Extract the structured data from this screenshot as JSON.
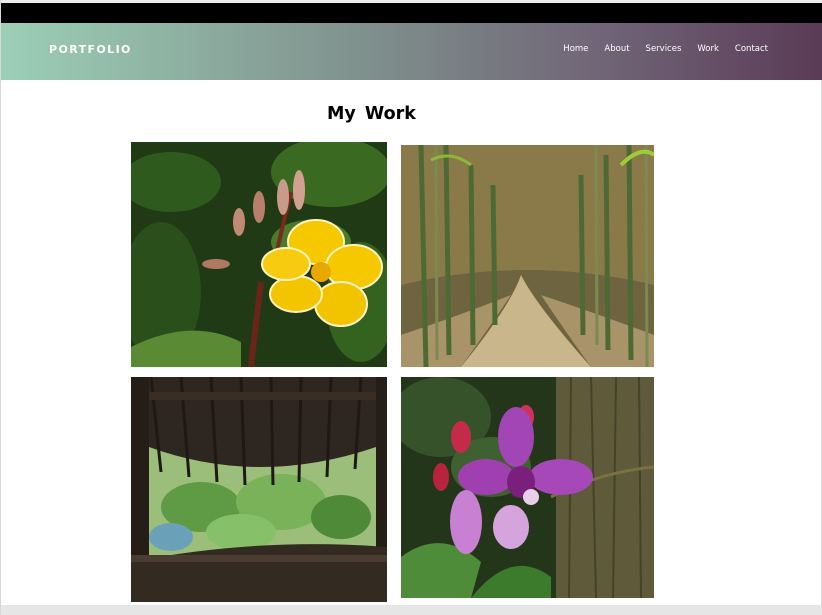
{
  "header": {
    "brand": "PORTFOLIO",
    "nav": [
      {
        "label": "Home"
      },
      {
        "label": "About"
      },
      {
        "label": "Services"
      },
      {
        "label": "Work"
      },
      {
        "label": "Contact"
      }
    ]
  },
  "work": {
    "title": "My  Work",
    "images": [
      {
        "subject": "yellow plumeria flower"
      },
      {
        "subject": "bamboo forest path"
      },
      {
        "subject": "view through thatched hut window"
      },
      {
        "subject": "purple orchid on tree"
      }
    ]
  },
  "colors": {
    "nav_gradient_start": "#9ccfb6",
    "nav_gradient_end": "#5a3b56",
    "top_band": "#000000",
    "title": "#000000"
  }
}
